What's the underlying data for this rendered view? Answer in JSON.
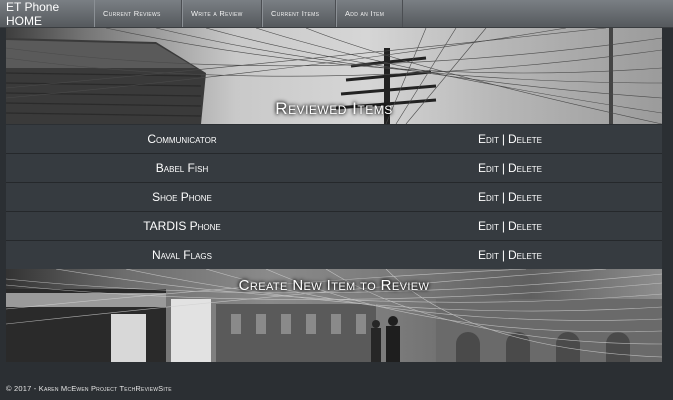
{
  "navbar": {
    "brand": "ET Phone HOME",
    "items": [
      {
        "label": "Current Reviews"
      },
      {
        "label": "Write a Review"
      },
      {
        "label": "Current Items"
      },
      {
        "label": "Add an Item"
      }
    ]
  },
  "banner": {
    "title": "Reviewed Items"
  },
  "items": [
    {
      "name": "Communicator",
      "edit": "Edit",
      "separator": "|",
      "delete": "Delete"
    },
    {
      "name": "Babel Fish",
      "edit": "Edit",
      "separator": "|",
      "delete": "Delete"
    },
    {
      "name": "Shoe Phone",
      "edit": "Edit",
      "separator": "|",
      "delete": "Delete"
    },
    {
      "name": "TARDIS Phone",
      "edit": "Edit",
      "separator": "|",
      "delete": "Delete"
    },
    {
      "name": "Naval Flags",
      "edit": "Edit",
      "separator": "|",
      "delete": "Delete"
    }
  ],
  "create": {
    "title": "Create New Item to Review"
  },
  "footer": {
    "text": "© 2017 - Karen McEwen Project TechReviewSite"
  },
  "colors": {
    "navbar": "#6a6f74",
    "row_background": "#363b40",
    "page_background": "#2b2f33"
  }
}
